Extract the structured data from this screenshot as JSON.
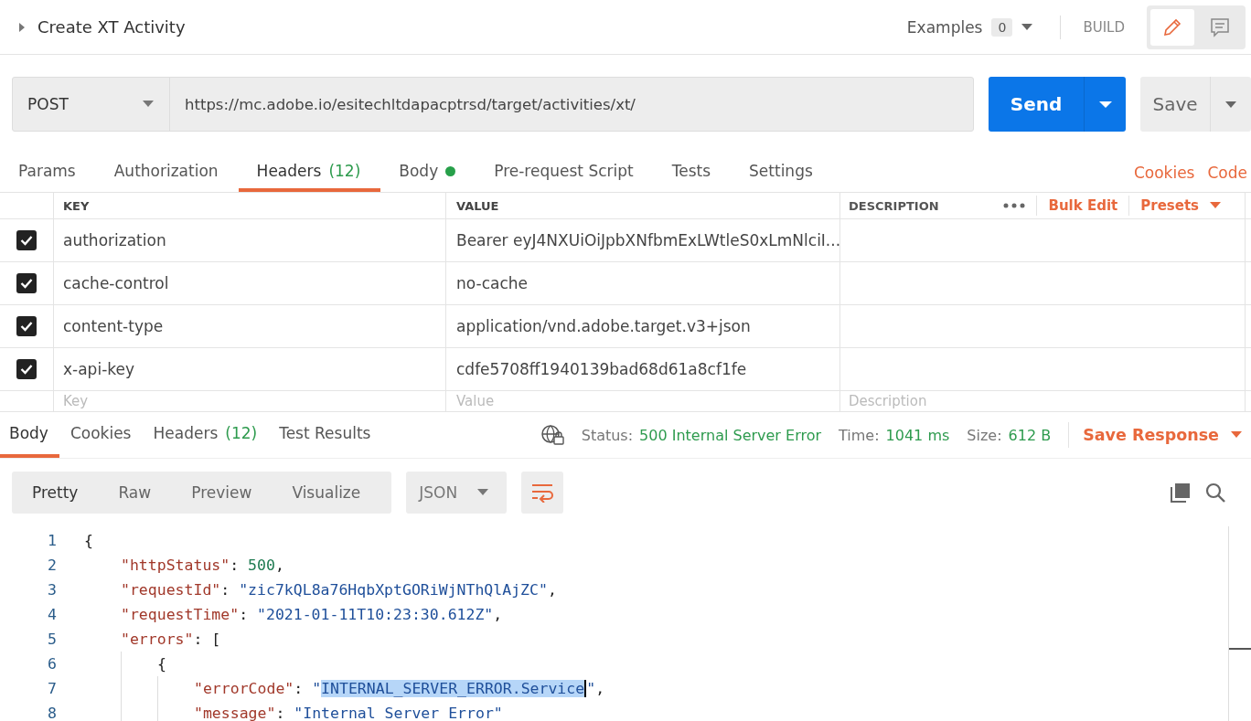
{
  "request": {
    "title": "Create XT Activity",
    "examples_label": "Examples",
    "examples_count": "0",
    "mode": "BUILD"
  },
  "side_modes": [
    {
      "kind": "edit",
      "selected": true
    },
    {
      "kind": "comments",
      "selected": false
    }
  ],
  "method": "POST",
  "url": "https://mc.adobe.io/esitechltdapacptrsd/target/activities/xt/",
  "send": "Send",
  "save": "Save",
  "request_tabs": [
    {
      "label": "Params",
      "selected": false
    },
    {
      "label": "Authorization",
      "selected": false
    },
    {
      "label": "Headers",
      "count": "(12)",
      "selected": true
    },
    {
      "label": "Body",
      "dot": true,
      "selected": false
    },
    {
      "label": "Pre-request Script",
      "selected": false
    },
    {
      "label": "Tests",
      "selected": false
    },
    {
      "label": "Settings",
      "selected": false
    }
  ],
  "request_links": [
    "Cookies",
    "Code"
  ],
  "headers_table": {
    "columns": [
      "KEY",
      "VALUE",
      "DESCRIPTION"
    ],
    "actions": [
      "Bulk Edit",
      "Presets"
    ],
    "rows": [
      {
        "checked": true,
        "key": "authorization",
        "value": "Bearer eyJ4NXUiOiJpbXNfbmExLWtleS0xLmNlciI..."
      },
      {
        "checked": true,
        "key": "cache-control",
        "value": "no-cache"
      },
      {
        "checked": true,
        "key": "content-type",
        "value": "application/vnd.adobe.target.v3+json"
      },
      {
        "checked": true,
        "key": "x-api-key",
        "value": "cdfe5708ff1940139bad68d61a8cf1fe"
      }
    ],
    "placeholders": {
      "key": "Key",
      "value": "Value",
      "description": "Description"
    }
  },
  "response_tabs": [
    {
      "label": "Body",
      "selected": true
    },
    {
      "label": "Cookies",
      "selected": false
    },
    {
      "label": "Headers",
      "count": "(12)",
      "selected": false
    },
    {
      "label": "Test Results",
      "selected": false
    }
  ],
  "status": {
    "status_label": "Status:",
    "status": "500 Internal Server Error",
    "time_label": "Time:",
    "time": "1041 ms",
    "size_label": "Size:",
    "size": "612 B",
    "save_response": "Save Response"
  },
  "view_modes": [
    {
      "label": "Pretty",
      "selected": true
    },
    {
      "label": "Raw",
      "selected": false
    },
    {
      "label": "Preview",
      "selected": false
    },
    {
      "label": "Visualize",
      "selected": false
    }
  ],
  "format": "JSON",
  "wrap": true,
  "code_lines": [
    {
      "n": "1",
      "tokens": [
        {
          "kind": "punct",
          "text": "{"
        }
      ],
      "children": [
        {
          "n": "2",
          "tokens": [
            {
              "kind": "key",
              "text": "\"httpStatus\""
            },
            {
              "kind": "punct",
              "text": ": "
            },
            {
              "kind": "number",
              "text": "500"
            },
            {
              "kind": "punct",
              "text": ","
            }
          ]
        },
        {
          "n": "3",
          "tokens": [
            {
              "kind": "key",
              "text": "\"requestId\""
            },
            {
              "kind": "punct",
              "text": ": "
            },
            {
              "kind": "string",
              "text": "\"zic7kQL8a76HqbXptGORiWjNThQlAjZC\""
            },
            {
              "kind": "punct",
              "text": ","
            }
          ]
        },
        {
          "n": "4",
          "tokens": [
            {
              "kind": "key",
              "text": "\"requestTime\""
            },
            {
              "kind": "punct",
              "text": ": "
            },
            {
              "kind": "string",
              "text": "\"2021-01-11T10:23:30.612Z\""
            },
            {
              "kind": "punct",
              "text": ","
            }
          ]
        },
        {
          "n": "5",
          "tokens": [
            {
              "kind": "key",
              "text": "\"errors\""
            },
            {
              "kind": "punct",
              "text": ": ["
            }
          ],
          "children": [
            {
              "n": "6",
              "tokens": [
                {
                  "kind": "punct",
                  "text": "{"
                }
              ],
              "children": [
                {
                  "n": "7",
                  "tokens": [
                    {
                      "kind": "key",
                      "text": "\"errorCode\""
                    },
                    {
                      "kind": "punct",
                      "text": ": "
                    },
                    {
                      "kind": "string",
                      "text": "\""
                    },
                    {
                      "kind": "selection",
                      "text": "INTERNAL_SERVER_ERROR.Service"
                    },
                    {
                      "kind": "string",
                      "text": "\""
                    },
                    {
                      "kind": "punct",
                      "text": ","
                    }
                  ]
                },
                {
                  "n": "8",
                  "tokens": [
                    {
                      "kind": "key",
                      "text": "\"message\""
                    },
                    {
                      "kind": "punct",
                      "text": ": "
                    },
                    {
                      "kind": "string",
                      "text": "\"Internal Server Error\""
                    }
                  ]
                }
              ]
            }
          ]
        }
      ]
    }
  ]
}
